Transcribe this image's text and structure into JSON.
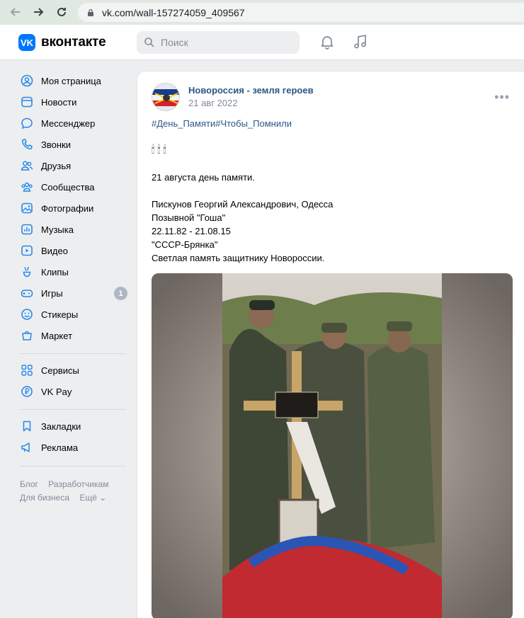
{
  "browser": {
    "url": "vk.com/wall-157274059_409567"
  },
  "header": {
    "logo_letter": "VK",
    "brand": "вконтакте",
    "search_placeholder": "Поиск"
  },
  "sidebar": {
    "items": [
      {
        "label": "Моя страница",
        "icon": "user-circle-icon"
      },
      {
        "label": "Новости",
        "icon": "news-icon"
      },
      {
        "label": "Мессенджер",
        "icon": "message-icon"
      },
      {
        "label": "Звонки",
        "icon": "phone-icon"
      },
      {
        "label": "Друзья",
        "icon": "friends-icon"
      },
      {
        "label": "Сообщества",
        "icon": "communities-icon"
      },
      {
        "label": "Фотографии",
        "icon": "photo-icon"
      },
      {
        "label": "Музыка",
        "icon": "music-icon"
      },
      {
        "label": "Видео",
        "icon": "video-icon"
      },
      {
        "label": "Клипы",
        "icon": "clips-icon"
      },
      {
        "label": "Игры",
        "icon": "games-icon",
        "badge": "1"
      },
      {
        "label": "Стикеры",
        "icon": "stickers-icon"
      },
      {
        "label": "Маркет",
        "icon": "market-icon"
      },
      {
        "label": "Сервисы",
        "icon": "services-icon"
      },
      {
        "label": "VK Pay",
        "icon": "vkpay-icon"
      },
      {
        "label": "Закладки",
        "icon": "bookmark-icon"
      },
      {
        "label": "Реклама",
        "icon": "ads-icon"
      }
    ],
    "footer": {
      "blog": "Блог",
      "developers": "Разработчикам",
      "business": "Для бизнеса",
      "more": "Ещё ⌄"
    }
  },
  "post": {
    "author": "Новороссия - земля героев",
    "date": "21 авг 2022",
    "hashtags": "#День_Памяти#Чтобы_Помнили",
    "candles": "🕯🕯🕯",
    "lines": {
      "l1": "21 августа день памяти.",
      "l2": "Пискунов Георгий Александрович, Одесса",
      "l3": "Позывной \"Гоша\"",
      "l4": "22.11.82 - 21.08.15",
      "l5": "\"СССР-Брянка\"",
      "l6": "Светлая память защитнику Новороссии."
    }
  },
  "colors": {
    "accent": "#2688eb",
    "link": "#2a5885",
    "brand": "#0077ff"
  }
}
